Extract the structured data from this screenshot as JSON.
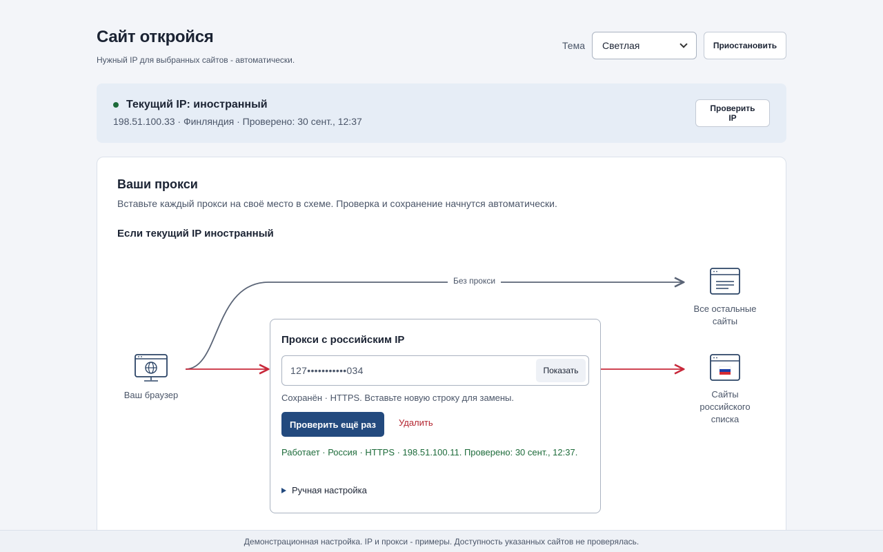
{
  "header": {
    "title": "Сайт откройся",
    "subtitle": "Нужный IP для выбранных сайтов - автоматически.",
    "theme_label": "Тема",
    "theme_value": "Светлая",
    "pause_label": "Приостановить"
  },
  "ip_status": {
    "title": "Текущий IP: иностранный",
    "details": "198.51.100.33 · Финляндия · Проверено: 30 сент., 12:37",
    "check_label": "Проверить IP",
    "status_color": "#1d6b3a"
  },
  "proxies": {
    "title": "Ваши прокси",
    "description": "Вставьте каждый прокси на своё место в схеме. Проверка и сохранение начнутся автоматически.",
    "scheme_title": "Если текущий IP иностранный",
    "diagram": {
      "browser_label": "Ваш браузер",
      "no_proxy_label": "Без прокси",
      "other_sites_label": [
        "Все остальные",
        "сайты"
      ],
      "ru_sites_label": [
        "Сайты",
        "российского",
        "списка"
      ]
    },
    "ru_proxy": {
      "title": "Прокси с российским IP",
      "value": "127•••••••••••034",
      "show_label": "Показать",
      "saved_note": "Сохранён · HTTPS. Вставьте новую строку для замены.",
      "recheck_label": "Проверить ещё раз",
      "delete_label": "Удалить",
      "status": "Работает · Россия · HTTPS · 198.51.100.11. Проверено: 30 сент., 12:37.",
      "manual_label": "Ручная настройка"
    }
  },
  "footer": {
    "text": "Демонстрационная настройка. IP и прокси - примеры. Доступность указанных сайтов не проверялась."
  },
  "colors": {
    "accent": "#234a7e",
    "danger": "#b3242f",
    "success": "#1d6b3a",
    "route_red": "#c8283a",
    "route_gray": "#5a6476"
  }
}
